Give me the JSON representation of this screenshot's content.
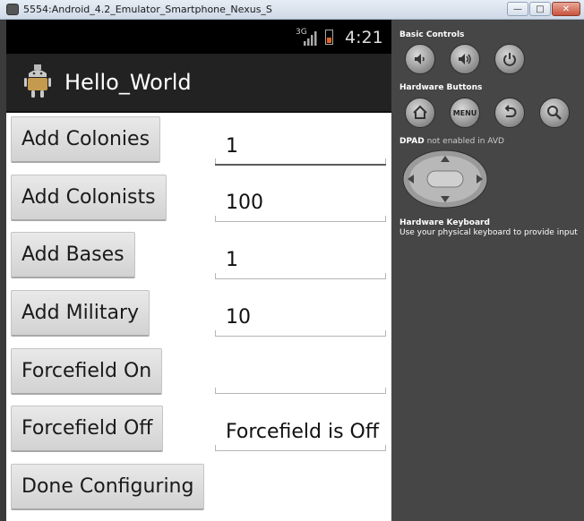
{
  "window": {
    "title": "5554:Android_4.2_Emulator_Smartphone_Nexus_S"
  },
  "status_bar": {
    "network": "3G",
    "time": "4:21"
  },
  "action_bar": {
    "title": "Hello_World"
  },
  "rows": [
    {
      "button": "Add Colonies",
      "value": "1"
    },
    {
      "button": "Add Colonists",
      "value": "100"
    },
    {
      "button": "Add Bases",
      "value": "1"
    },
    {
      "button": "Add Military",
      "value": "10"
    },
    {
      "button": "Forcefield On",
      "value": ""
    },
    {
      "button": "Forcefield Off",
      "value": "Forcefield is Off"
    },
    {
      "button": "Done Configuring"
    }
  ],
  "controls": {
    "basic_controls_label": "Basic Controls",
    "hardware_buttons_label": "Hardware Buttons",
    "menu_label": "MENU",
    "dpad_label": "DPAD",
    "dpad_note": "not enabled in AVD",
    "keyboard_label": "Hardware Keyboard",
    "keyboard_note": "Use your physical keyboard to provide input"
  }
}
